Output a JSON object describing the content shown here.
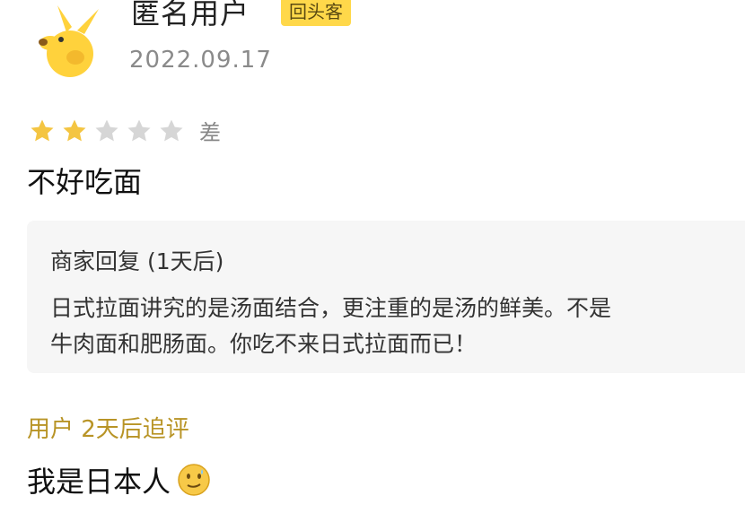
{
  "review": {
    "username": "匿名用户",
    "badge": "回头客",
    "date": "2022.09.17",
    "rating": {
      "stars_filled": 2,
      "stars_total": 5,
      "label": "差"
    },
    "text": "不好吃面"
  },
  "merchant_reply": {
    "title": "商家回复 (1天后)",
    "line1": "日式拉面讲究的是汤面结合，更注重的是汤的鲜美。不是",
    "line2": "牛肉面和肥肠面。你吃不来日式拉面而已！"
  },
  "followup": {
    "label": "用户 2天后追评",
    "text": "我是日本人",
    "emoji": "awkward-smile-emoji"
  },
  "colors": {
    "star_filled": "#f4c542",
    "star_empty": "#d6d6d6",
    "badge_bg": "#ffd84a",
    "followup_label": "#b89426",
    "reply_bg": "#f6f6f6"
  }
}
